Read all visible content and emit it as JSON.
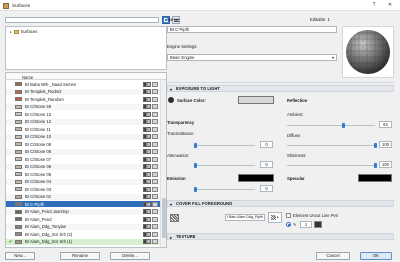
{
  "window": {
    "title": "Surfaces",
    "help": "?",
    "close": "✕"
  },
  "search": {
    "placeholder": "",
    "value": ""
  },
  "tree": {
    "root_label": "Surfaces"
  },
  "list": {
    "header_name": "Name",
    "rows": [
      {
        "name": "BI Baba Mrh _Naad Semen",
        "color": "#9a6a4a",
        "state": "normal"
      },
      {
        "name": "BI Templek_Rodm2",
        "color": "#b76a4a",
        "state": "normal"
      },
      {
        "name": "BI Templek_Random",
        "color": "#b56347",
        "state": "normal"
      },
      {
        "name": "BI C/Stone 49",
        "color": "#c9b8a8",
        "state": "normal"
      },
      {
        "name": "BI C/Stone 13",
        "color": "#d4c6b6",
        "state": "normal"
      },
      {
        "name": "BI C/Stone 12",
        "color": "#c8b9a7",
        "state": "normal"
      },
      {
        "name": "BI C/Stone 11",
        "color": "#c2b3a3",
        "state": "normal"
      },
      {
        "name": "BI C/Stone 10",
        "color": "#cdbfae",
        "state": "normal"
      },
      {
        "name": "BI C/Stone 09",
        "color": "#c6b5a4",
        "state": "normal"
      },
      {
        "name": "BI C/Stone 08",
        "color": "#bfae9c",
        "state": "normal"
      },
      {
        "name": "BI C/Stone 07",
        "color": "#d0c2b3",
        "state": "normal"
      },
      {
        "name": "BI C/Stone 06",
        "color": "#c3b1a0",
        "state": "normal"
      },
      {
        "name": "BI C/Stone 05",
        "color": "#c9baa9",
        "state": "normal"
      },
      {
        "name": "BI C/Stone 04",
        "color": "#cbb9a6",
        "state": "normal"
      },
      {
        "name": "BI C/Stone 03",
        "color": "#c5b6a6",
        "state": "normal"
      },
      {
        "name": "BI C/Stone 01",
        "color": "#bda997",
        "state": "normal"
      },
      {
        "name": "BI C-Pipfh",
        "color": "#7a7a7a",
        "state": "selected"
      },
      {
        "name": "BI Alam_Pond Jusntrnp",
        "color": "#5c6b52",
        "state": "normal"
      },
      {
        "name": "BI Alam_Pond",
        "color": "#66735b",
        "state": "normal"
      },
      {
        "name": "BI Alam_Ddg_Tonylan",
        "color": "#8a7f72",
        "state": "normal"
      },
      {
        "name": "BI Alam_Ddg_Sor Srh (2)",
        "color": "#9b8c7d",
        "state": "normal"
      },
      {
        "name": "BI Alam_Ddg_Sor Srh (1)",
        "color": "#a59585",
        "state": "checked"
      }
    ]
  },
  "buttons": {
    "new": "New...",
    "rename": "Rename",
    "delete": "Delete...",
    "cancel": "Cancel",
    "ok": "OK"
  },
  "details": {
    "name_label": "Name:",
    "editable_label": "Editable: 1",
    "name_value": "BI C-Pipfh",
    "engine_label": "Engine Settings:",
    "engine_value": "Basic Engine"
  },
  "exposure": {
    "title": "EXPOSURE TO LIGHT",
    "surface_color_label": "Surface Color:",
    "surface_color": "#d9d9d9",
    "reflection_title": "Reflection",
    "ambient_label": "Ambient:",
    "ambient_value": "64",
    "ambient_frac": 0.64,
    "diffuse_label": "Diffuse:",
    "diffuse_value": "100",
    "diffuse_frac": 1.0,
    "shininess_label": "Shininess:",
    "shininess_value": "100",
    "shininess_frac": 1.0,
    "specular_title": "Specular",
    "specular_color": "#000000",
    "transparency_title": "Transparency",
    "transmittance_label": "Transmittance:",
    "transmittance_value": "0",
    "transmittance_frac": 0,
    "attenuation_label": "Attenuation:",
    "attenuation_value": "0",
    "attenuation_frac": 0,
    "emission_title": "Emission",
    "emission_color": "#000000",
    "emission_value": "0",
    "emission_frac": 0
  },
  "fill": {
    "title": "COVER FILL FOREGROUND",
    "fill_name": "I Batu Alam Ddg_Pipfh",
    "element_pen_label": "Element Uncut Line Pen",
    "pen_value": "1"
  },
  "texture": {
    "title": "TEXTURE"
  },
  "colors": {
    "accent": "#2e6fb8",
    "selected_row": "#2e6fb8",
    "checked_row": "#d8f0d2"
  }
}
